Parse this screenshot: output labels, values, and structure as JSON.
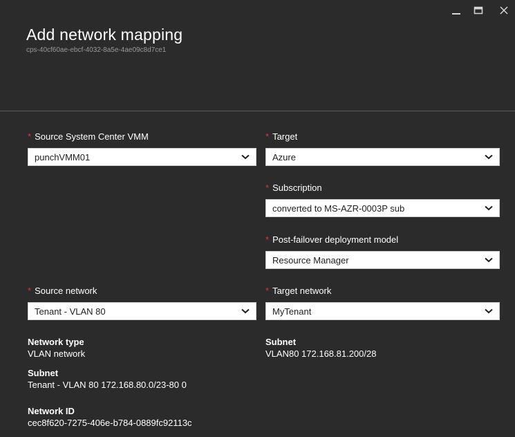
{
  "blade": {
    "title": "Add network mapping",
    "subtitle": "cps-40cf60ae-ebcf-4032-8a5e-4ae09c8d7ce1"
  },
  "window_controls": {
    "minimize_icon": "minimize-icon",
    "maximize_icon": "maximize-icon",
    "close_icon": "close-icon"
  },
  "required_marker": "*",
  "fields": {
    "source_vmm": {
      "label": "Source System Center VMM",
      "value": "punchVMM01"
    },
    "target": {
      "label": "Target",
      "value": "Azure"
    },
    "subscription": {
      "label": "Subscription",
      "value": "converted to MS-AZR-0003P sub"
    },
    "deployment_model": {
      "label": "Post-failover deployment model",
      "value": "Resource Manager"
    },
    "source_network": {
      "label": "Source network",
      "value": "Tenant - VLAN 80"
    },
    "target_network": {
      "label": "Target network",
      "value": "MyTenant"
    }
  },
  "source_details": {
    "network_type_label": "Network type",
    "network_type_value": "VLAN network",
    "subnet_label": "Subnet",
    "subnet_value": "Tenant - VLAN 80 172.168.80.0/23-80 0",
    "network_id_label": "Network ID",
    "network_id_value": "cec8f620-7275-406e-b784-0889fc92113c"
  },
  "target_details": {
    "subnet_label": "Subnet",
    "subnet_value": "VLAN80 172.168.81.200/28"
  },
  "colors": {
    "background": "#2b2b2b",
    "required": "#d9392f",
    "subtitle": "#9a9a9a",
    "input_bg": "#ffffff"
  }
}
